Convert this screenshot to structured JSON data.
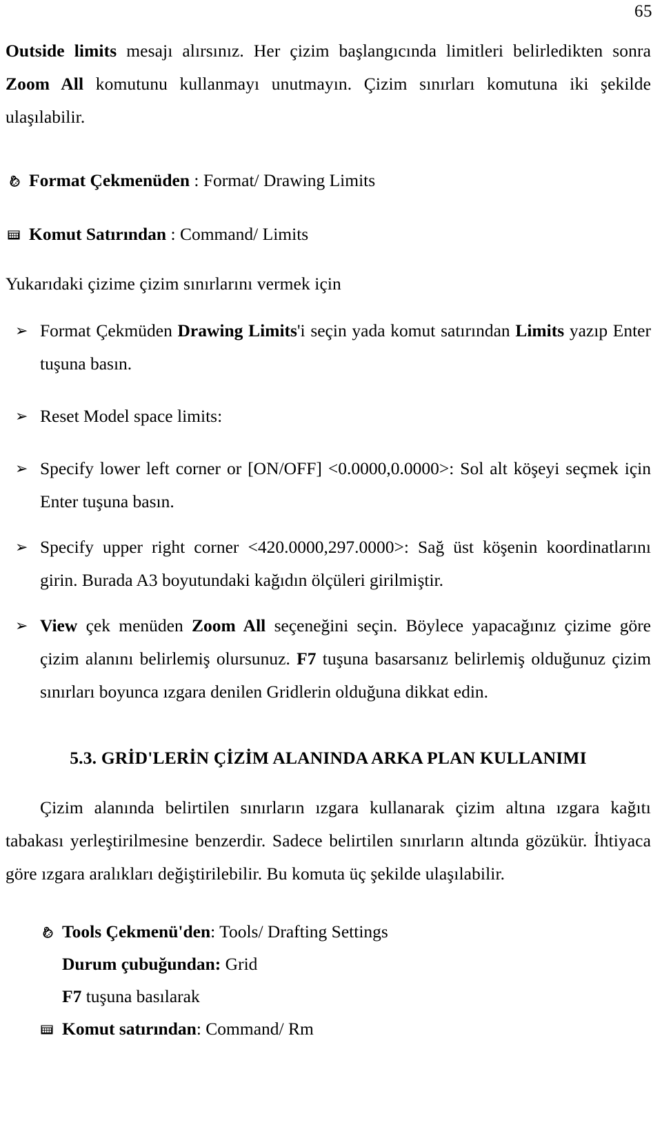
{
  "page": {
    "number": "65"
  },
  "intro": {
    "bold_lead": "Outside limits",
    "text_1": " mesajı alırsınız. Her çizim başlangıcında limitleri belirledikten sonra ",
    "bold_mid": "Zoom All",
    "text_2": " komutunu kullanmayı unutmayın. Çizim sınırları komutuna iki şekilde ulaşılabilir."
  },
  "access_methods": [
    {
      "icon": "mouse-icon",
      "label": "Format Çekmenüden",
      "separator": " : ",
      "value": "Format/ Drawing Limits"
    },
    {
      "icon": "keyboard-icon",
      "label": "Komut Satırından",
      "separator": " : ",
      "value": "Command/ Limits"
    }
  ],
  "lead_in": "Yukarıdaki çizime çizim sınırlarını vermek için",
  "bullet_char": "➢",
  "steps": [
    {
      "id": "step-format-menu",
      "pre": "Format Çekmüden ",
      "bold_1": "Drawing Limits",
      "mid": "'i seçin yada komut satırından ",
      "bold_2": "Limits",
      "post": " yazıp Enter tuşuna basın."
    },
    {
      "id": "step-reset-model-space",
      "text": "Reset Model space limits:"
    },
    {
      "id": "step-lower-left-corner",
      "text": "Specify lower left corner or [ON/OFF] <0.0000,0.0000>: Sol alt köşeyi seçmek için Enter tuşuna basın."
    },
    {
      "id": "step-upper-right-corner",
      "text": "Specify upper right corner <420.0000,297.0000>: Sağ üst köşenin koordinatlarını girin. Burada A3 boyutundaki kağıdın ölçüleri girilmiştir."
    },
    {
      "id": "step-zoom-all",
      "bold_1": "View",
      "mid_1": " çek menüden ",
      "bold_2": "Zoom All",
      "mid_2": " seçeneğini seçin. Böylece yapacağınız çizime göre çizim alanını belirlemiş olursunuz. ",
      "bold_3": "F7",
      "post": " tuşuna basarsanız belirlemiş olduğunuz çizim sınırları boyunca ızgara denilen Gridlerin olduğuna dikkat edin."
    }
  ],
  "section": {
    "heading": "5.3. GRİD'LERİN ÇİZİM ALANINDA ARKA PLAN KULLANIMI",
    "paragraph": "Çizim alanında belirtilen sınırların ızgara kullanarak çizim altına ızgara kağıtı tabakası yerleştirilmesine benzerdir. Sadece belirtilen sınırların altında gözükür. İhtiyaca  göre ızgara aralıkları değiştirilebilir. Bu komuta üç şekilde ulaşılabilir."
  },
  "grid_access_methods": [
    {
      "id": "tools-menu-method",
      "icon": "mouse-icon",
      "label": "Tools Çekmenü'den",
      "separator": ": ",
      "value": "Tools/ Drafting Settings"
    },
    {
      "id": "status-bar-method",
      "icon": "none",
      "label": "Durum çubuğundan:",
      "separator": " ",
      "value": "Grid"
    },
    {
      "id": "function-key-method",
      "icon": "none",
      "label": "F7",
      "separator": " ",
      "value": "tuşuna basılarak"
    },
    {
      "id": "command-line-method",
      "icon": "keyboard-icon",
      "label": "Komut satırından",
      "separator": ": ",
      "value": "Command/ Rm"
    }
  ]
}
